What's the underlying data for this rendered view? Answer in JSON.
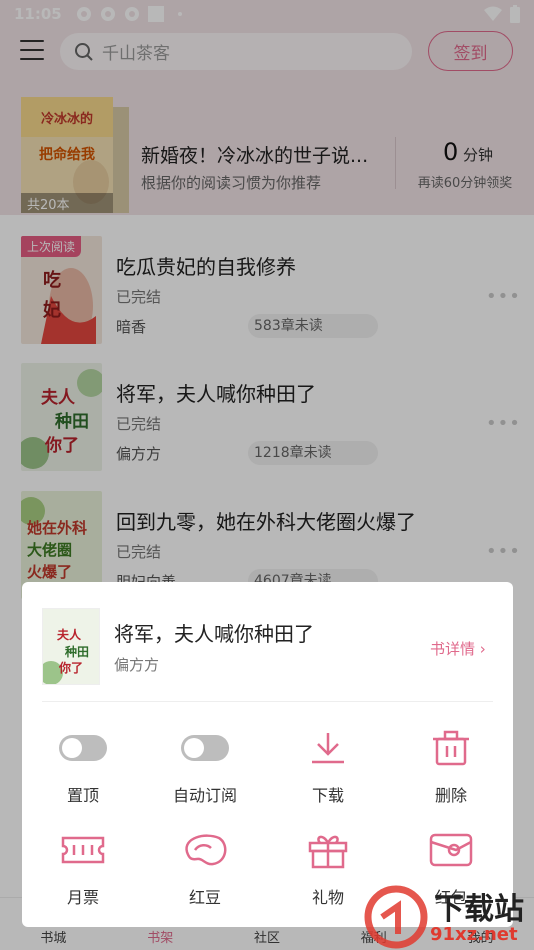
{
  "status_bar": {
    "time": "11:05"
  },
  "header": {
    "search_placeholder": "千山茶客",
    "signin_label": "签到"
  },
  "recommend": {
    "cover_title": "新婚夜冷冰冰的世子说把命给我",
    "count_label": "共20本",
    "title": "新婚夜！冷冰冰的世子说...",
    "subtitle": "根据你的阅读习惯为你推荐",
    "minutes_value": "0",
    "minutes_unit": "分钟",
    "minutes_hint": "再读60分钟领奖"
  },
  "books": [
    {
      "title": "吃瓜贵妃的自我修养",
      "status": "已完结",
      "author": "暗香",
      "chapters": "583章未读",
      "badge": "上次阅读",
      "cover_text": "吃瓜贵妃"
    },
    {
      "title": "将军，夫人喊你种田了",
      "status": "已完结",
      "author": "偏方方",
      "chapters": "1218章未读",
      "cover_text": "夫人喊你种田了"
    },
    {
      "title": "回到九零，她在外科大佬圈火爆了",
      "status": "已完结",
      "author": "胆妇向善",
      "chapters": "4607章未读",
      "cover_text": "她在外科大佬圈火爆了"
    }
  ],
  "popup": {
    "title": "将军，夫人喊你种田了",
    "author": "偏方方",
    "detail_label": "书详情",
    "actions": [
      {
        "label": "置顶",
        "icon": "toggle-off-icon"
      },
      {
        "label": "自动订阅",
        "icon": "toggle-off-icon"
      },
      {
        "label": "下载",
        "icon": "download-icon"
      },
      {
        "label": "删除",
        "icon": "trash-icon"
      },
      {
        "label": "月票",
        "icon": "ticket-icon"
      },
      {
        "label": "红豆",
        "icon": "red-bean-icon"
      },
      {
        "label": "礼物",
        "icon": "gift-icon"
      },
      {
        "label": "红包",
        "icon": "red-packet-icon"
      }
    ]
  },
  "bottom_nav": [
    "书城",
    "书架",
    "社区",
    "福利",
    "我的"
  ],
  "watermark": {
    "text": "下载站",
    "domain": "91xz.net"
  },
  "colors": {
    "accent": "#e06a8c",
    "top_bg": "#f2e3e6"
  }
}
